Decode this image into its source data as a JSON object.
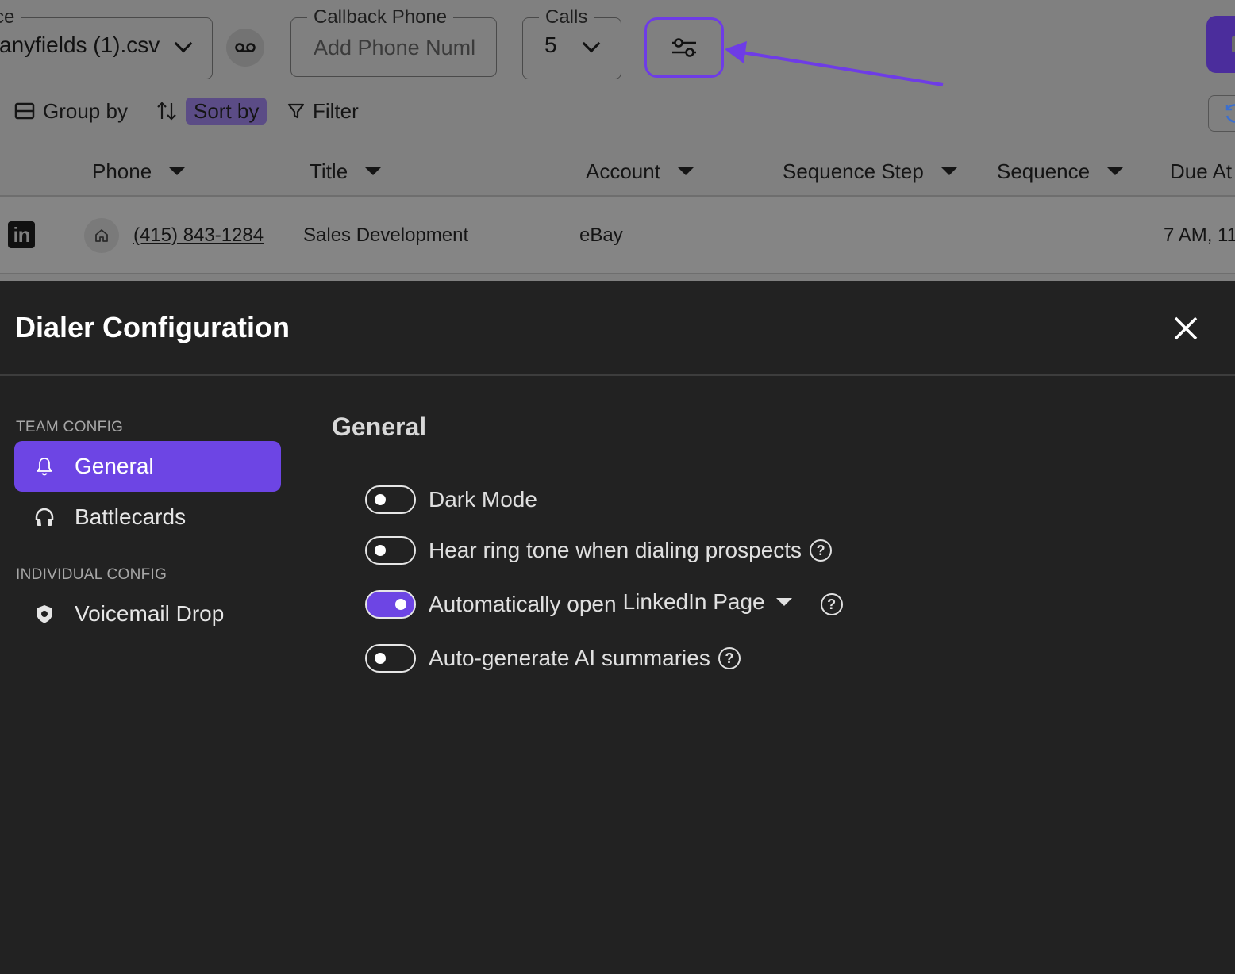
{
  "background": {
    "source_field": {
      "legend": "ce",
      "value": "anyfields (1).csv"
    },
    "callback_field": {
      "legend": "Callback Phone",
      "placeholder": "Add Phone Numl"
    },
    "calls_field": {
      "legend": "Calls",
      "value": "5"
    },
    "toolbar": {
      "group_by": "Group by",
      "sort_by": "Sort by",
      "filter": "Filter"
    },
    "columns": [
      "Phone",
      "Title",
      "Account",
      "Sequence Step",
      "Sequence",
      "Due At"
    ],
    "row": {
      "phone": "(415) 843-1284",
      "title": "Sales Development",
      "account": "eBay",
      "due_at": "7 AM, 11"
    },
    "linkedin_glyph": "in",
    "accent": "#6d45e4"
  },
  "modal": {
    "title": "Dialer Configuration",
    "team_config_label": "TEAM CONFIG",
    "individual_config_label": "INDIVIDUAL CONFIG",
    "nav": {
      "general": "General",
      "battlecards": "Battlecards",
      "voicemail_drop": "Voicemail Drop"
    },
    "content_title": "General",
    "settings": {
      "dark_mode": {
        "label": "Dark Mode",
        "enabled": false
      },
      "ring_tone": {
        "label": "Hear ring tone when dialing prospects",
        "enabled": false
      },
      "auto_open": {
        "label": "Automatically open",
        "selected": "LinkedIn Page",
        "enabled": true
      },
      "ai_summaries": {
        "label": "Auto-generate AI summaries",
        "enabled": false
      }
    },
    "help_glyph": "?"
  }
}
